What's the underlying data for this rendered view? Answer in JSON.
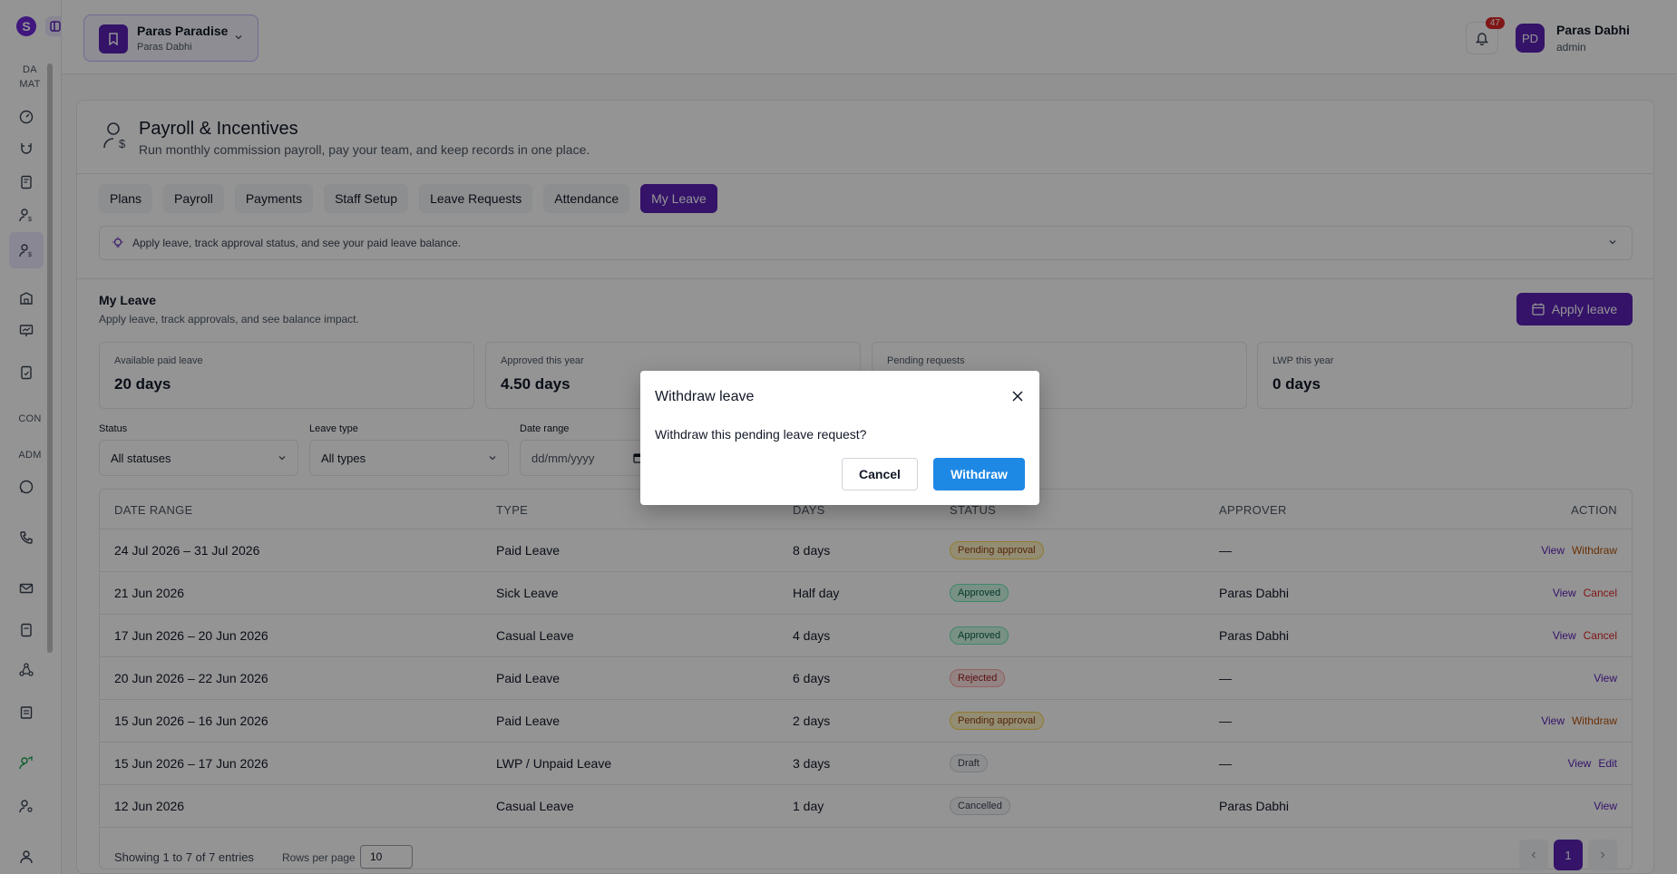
{
  "sidebar": {
    "section_da": "DA",
    "section_mat": "MAT",
    "section_con": "CON",
    "section_adm": "ADM"
  },
  "header": {
    "org_name": "Paras Paradise",
    "org_owner": "Paras Dabhi",
    "notif_count": "47",
    "avatar_initials": "PD",
    "user_name": "Paras Dabhi",
    "user_role": "admin"
  },
  "page": {
    "title": "Payroll & Incentives",
    "subtitle": "Run monthly commission payroll, pay your team, and keep records in one place.",
    "tabs": [
      "Plans",
      "Payroll",
      "Payments",
      "Staff Setup",
      "Leave Requests",
      "Attendance",
      "My Leave"
    ],
    "active_tab": "My Leave",
    "tip": "Apply leave, track approval status, and see your paid leave balance."
  },
  "my_leave": {
    "title": "My Leave",
    "subtitle": "Apply leave, track approvals, and see balance impact.",
    "apply_label": "Apply leave",
    "cards": [
      {
        "label": "Available paid leave",
        "value": "20 days"
      },
      {
        "label": "Approved this year",
        "value": "4.50 days"
      },
      {
        "label": "Pending requests",
        "value": ""
      },
      {
        "label": "LWP this year",
        "value": "0 days"
      }
    ],
    "filters": {
      "status_label": "Status",
      "status_value": "All statuses",
      "type_label": "Leave type",
      "type_value": "All types",
      "date_label": "Date range",
      "date_placeholder": "dd/mm/yyyy"
    }
  },
  "table": {
    "headers": [
      "DATE RANGE",
      "TYPE",
      "DAYS",
      "STATUS",
      "APPROVER",
      "ACTION"
    ],
    "rows": [
      {
        "range": "24 Jul 2026 – 31 Jul 2026",
        "type": "Paid Leave",
        "days": "8 days",
        "status": "Pending approval",
        "approver": "—",
        "actions": [
          "View",
          "Withdraw"
        ]
      },
      {
        "range": "21 Jun 2026",
        "type": "Sick Leave",
        "days": "Half day",
        "status": "Approved",
        "approver": "Paras Dabhi",
        "actions": [
          "View",
          "Cancel"
        ]
      },
      {
        "range": "17 Jun 2026 – 20 Jun 2026",
        "type": "Casual Leave",
        "days": "4 days",
        "status": "Approved",
        "approver": "Paras Dabhi",
        "actions": [
          "View",
          "Cancel"
        ]
      },
      {
        "range": "20 Jun 2026 – 22 Jun 2026",
        "type": "Paid Leave",
        "days": "6 days",
        "status": "Rejected",
        "approver": "—",
        "actions": [
          "View"
        ]
      },
      {
        "range": "15 Jun 2026 – 16 Jun 2026",
        "type": "Paid Leave",
        "days": "2 days",
        "status": "Pending approval",
        "approver": "—",
        "actions": [
          "View",
          "Withdraw"
        ]
      },
      {
        "range": "15 Jun 2026 – 17 Jun 2026",
        "type": "LWP / Unpaid Leave",
        "days": "3 days",
        "status": "Draft",
        "approver": "—",
        "actions": [
          "View",
          "Edit"
        ]
      },
      {
        "range": "12 Jun 2026",
        "type": "Casual Leave",
        "days": "1 day",
        "status": "Cancelled",
        "approver": "Paras Dabhi",
        "actions": [
          "View"
        ]
      }
    ],
    "showing": "Showing 1 to 7 of 7 entries",
    "rows_per_page_label": "Rows per page",
    "rows_per_page_value": "10",
    "page": "1"
  },
  "modal": {
    "title": "Withdraw leave",
    "message": "Withdraw this pending leave request?",
    "cancel_label": "Cancel",
    "confirm_label": "Withdraw"
  },
  "colors": {
    "brand": "#5b21b6",
    "confirm": "#1e88e5",
    "pending_bg": "#fef3c7",
    "approved_bg": "#d1fae5",
    "rejected_bg": "#fee2e2",
    "neutral_bg": "#f3f4f6"
  }
}
